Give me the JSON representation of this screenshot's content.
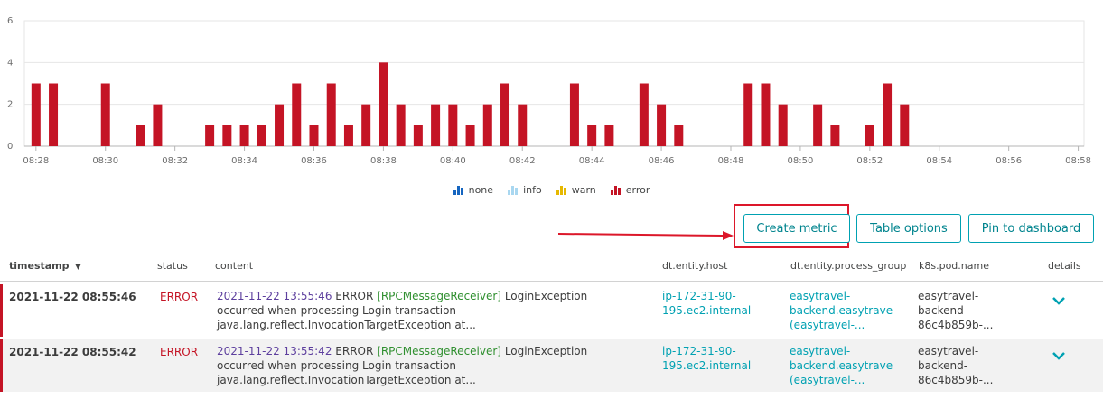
{
  "chart_data": {
    "type": "bar",
    "x_tick_labels": [
      "08:28",
      "08:30",
      "08:32",
      "08:34",
      "08:36",
      "08:38",
      "08:40",
      "08:42",
      "08:44",
      "08:46",
      "08:48",
      "08:50",
      "08:52",
      "08:54",
      "08:56",
      "08:58"
    ],
    "y_ticks": [
      0,
      2,
      4,
      6
    ],
    "ylim": [
      0,
      6
    ],
    "x_range_minutes": [
      "08:27:40",
      "08:58:10"
    ],
    "series": [
      {
        "name": "error",
        "color": "#c41425",
        "points": [
          {
            "t": "08:28:00",
            "v": 3
          },
          {
            "t": "08:28:30",
            "v": 3
          },
          {
            "t": "08:30:00",
            "v": 3
          },
          {
            "t": "08:31:00",
            "v": 1
          },
          {
            "t": "08:31:30",
            "v": 2
          },
          {
            "t": "08:33:00",
            "v": 1
          },
          {
            "t": "08:33:30",
            "v": 1
          },
          {
            "t": "08:34:00",
            "v": 1
          },
          {
            "t": "08:34:30",
            "v": 1
          },
          {
            "t": "08:35:00",
            "v": 2
          },
          {
            "t": "08:35:30",
            "v": 3
          },
          {
            "t": "08:36:00",
            "v": 1
          },
          {
            "t": "08:36:30",
            "v": 3
          },
          {
            "t": "08:37:00",
            "v": 1
          },
          {
            "t": "08:37:30",
            "v": 2
          },
          {
            "t": "08:38:00",
            "v": 4
          },
          {
            "t": "08:38:30",
            "v": 2
          },
          {
            "t": "08:39:00",
            "v": 1
          },
          {
            "t": "08:39:30",
            "v": 2
          },
          {
            "t": "08:40:00",
            "v": 2
          },
          {
            "t": "08:40:30",
            "v": 1
          },
          {
            "t": "08:41:00",
            "v": 2
          },
          {
            "t": "08:41:30",
            "v": 3
          },
          {
            "t": "08:42:00",
            "v": 2
          },
          {
            "t": "08:43:30",
            "v": 3
          },
          {
            "t": "08:44:00",
            "v": 1
          },
          {
            "t": "08:44:30",
            "v": 1
          },
          {
            "t": "08:45:30",
            "v": 3
          },
          {
            "t": "08:46:00",
            "v": 2
          },
          {
            "t": "08:46:30",
            "v": 1
          },
          {
            "t": "08:48:30",
            "v": 3
          },
          {
            "t": "08:49:00",
            "v": 3
          },
          {
            "t": "08:49:30",
            "v": 2
          },
          {
            "t": "08:50:30",
            "v": 2
          },
          {
            "t": "08:51:00",
            "v": 1
          },
          {
            "t": "08:52:00",
            "v": 1
          },
          {
            "t": "08:52:30",
            "v": 3
          },
          {
            "t": "08:53:00",
            "v": 2
          }
        ]
      }
    ],
    "grid": true,
    "legend_position": "bottom-center"
  },
  "legend": [
    {
      "label": "none",
      "color": "#1565c0"
    },
    {
      "label": "info",
      "color": "#a9d7f0"
    },
    {
      "label": "warn",
      "color": "#e6b800"
    },
    {
      "label": "error",
      "color": "#c41425"
    }
  ],
  "toolbar": {
    "create_metric": "Create metric",
    "table_options": "Table options",
    "pin_to_dashboard": "Pin to dashboard"
  },
  "table": {
    "headers": {
      "timestamp": "timestamp",
      "sort_indicator": "▼",
      "status": "status",
      "content": "content",
      "host": "dt.entity.host",
      "process_group": "dt.entity.process_group",
      "pod": "k8s.pod.name",
      "details": "details"
    },
    "rows": [
      {
        "timestamp": "2021-11-22 08:55:46",
        "status": "ERROR",
        "content_date": "2021-11-22 13:55:46",
        "content_level": "ERROR",
        "content_tag": "[RPCMessageReceiver]",
        "content_rest": "LoginException",
        "content_line2": "occurred when processing Login transaction",
        "content_line3": "java.lang.reflect.InvocationTargetException at...",
        "host_line1": "ip-172-31-90-",
        "host_line2": "195.ec2.internal",
        "pg_line1": "easytravel-",
        "pg_line2": "backend.easytrave",
        "pg_line3": "(easytravel-...",
        "pod_line1": "easytravel-",
        "pod_line2": "backend-",
        "pod_line3": "86c4b859b-..."
      },
      {
        "timestamp": "2021-11-22 08:55:42",
        "status": "ERROR",
        "content_date": "2021-11-22 13:55:42",
        "content_level": "ERROR",
        "content_tag": "[RPCMessageReceiver]",
        "content_rest": "LoginException",
        "content_line2": "occurred when processing Login transaction",
        "content_line3": "java.lang.reflect.InvocationTargetException at...",
        "host_line1": "ip-172-31-90-",
        "host_line2": "195.ec2.internal",
        "pg_line1": "easytravel-",
        "pg_line2": "backend.easytrave",
        "pg_line3": "(easytravel-...",
        "pod_line1": "easytravel-",
        "pod_line2": "backend-",
        "pod_line3": "86c4b859b-..."
      }
    ]
  }
}
